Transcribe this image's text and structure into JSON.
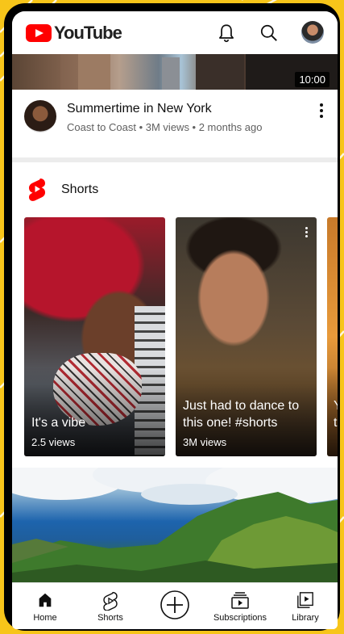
{
  "header": {
    "brand": "YouTube",
    "icons": [
      "bell-icon",
      "search-icon",
      "account-avatar"
    ]
  },
  "video": {
    "duration": "10:00",
    "title": "Summertime in New York",
    "meta": "Coast to Coast • 3M views • 2 months ago"
  },
  "shorts": {
    "section_label": "Shorts",
    "items": [
      {
        "title": "It's a vibe",
        "views": "2.5 views"
      },
      {
        "title_line1": "Just had to dance to",
        "title_line2": "this one! #shorts",
        "views": "3M views"
      },
      {
        "title_line1": "Y",
        "title_line2": "t"
      }
    ]
  },
  "nav": {
    "items": [
      {
        "label": "Home",
        "icon": "home-icon"
      },
      {
        "label": "Shorts",
        "icon": "shorts-icon"
      },
      {
        "label": "",
        "icon": "create-icon"
      },
      {
        "label": "Subscriptions",
        "icon": "subscriptions-icon"
      },
      {
        "label": "Library",
        "icon": "library-icon"
      }
    ]
  },
  "colors": {
    "background": "#f7c51a",
    "brand_red": "#ff0000",
    "text_primary": "#0f0f0f",
    "text_secondary": "#606060"
  }
}
